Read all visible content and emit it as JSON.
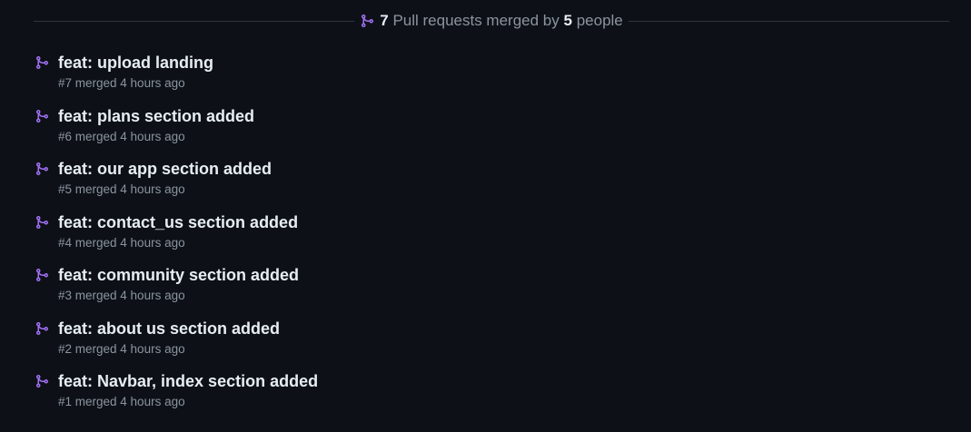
{
  "summary": {
    "pr_count": "7",
    "text_middle": "Pull requests merged by",
    "people_count": "5",
    "text_end": "people",
    "icon": "git-merge-icon"
  },
  "colors": {
    "background": "#0d1117",
    "merge_icon": "#a371f7",
    "text_primary": "#e6edf3",
    "text_muted": "#8b949e",
    "divider": "#30363d"
  },
  "pull_requests": [
    {
      "title": "feat: upload landing",
      "meta": "#7 merged 4 hours ago"
    },
    {
      "title": "feat: plans section added",
      "meta": "#6 merged 4 hours ago"
    },
    {
      "title": "feat: our app section added",
      "meta": "#5 merged 4 hours ago"
    },
    {
      "title": "feat: contact_us section added",
      "meta": "#4 merged 4 hours ago"
    },
    {
      "title": "feat: community section added",
      "meta": "#3 merged 4 hours ago"
    },
    {
      "title": "feat: about us section added",
      "meta": "#2 merged 4 hours ago"
    },
    {
      "title": "feat: Navbar, index section added",
      "meta": "#1 merged 4 hours ago"
    }
  ]
}
